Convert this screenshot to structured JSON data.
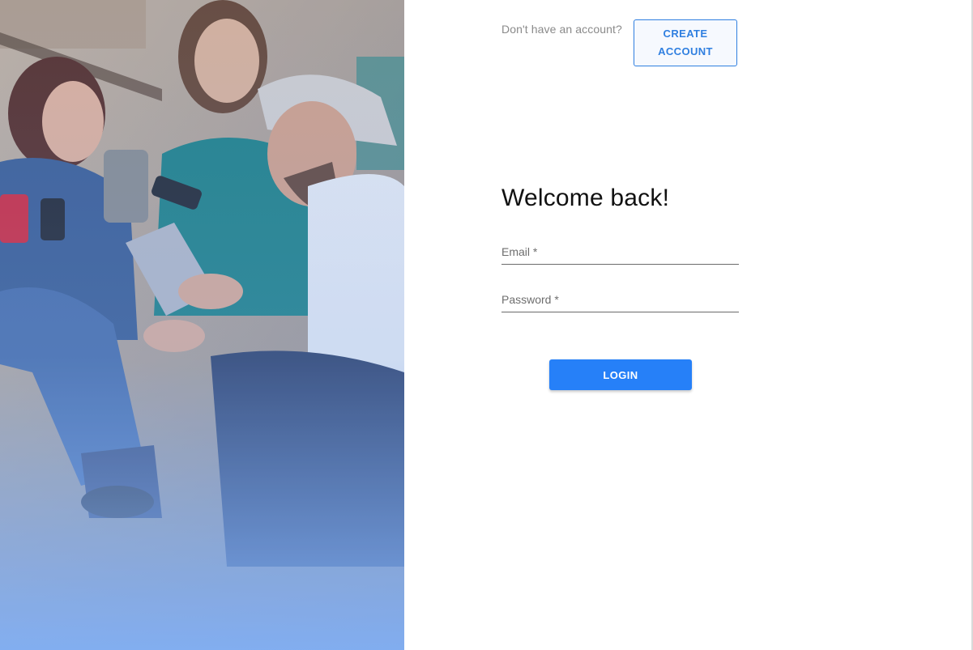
{
  "header": {
    "prompt_text": "Don't have an account?",
    "create_account_line1": "CREATE",
    "create_account_line2": "ACCOUNT"
  },
  "login_form": {
    "title": "Welcome back!",
    "email_label": "Email *",
    "email_value": "",
    "password_label": "Password *",
    "password_value": "",
    "login_label": "LOGIN"
  },
  "hero": {
    "description_icon": "friends-with-phones-photo"
  },
  "colors": {
    "accent": "#2680f8",
    "outline_accent": "#2f7fe0",
    "hero_tint": "#86b4f8"
  }
}
